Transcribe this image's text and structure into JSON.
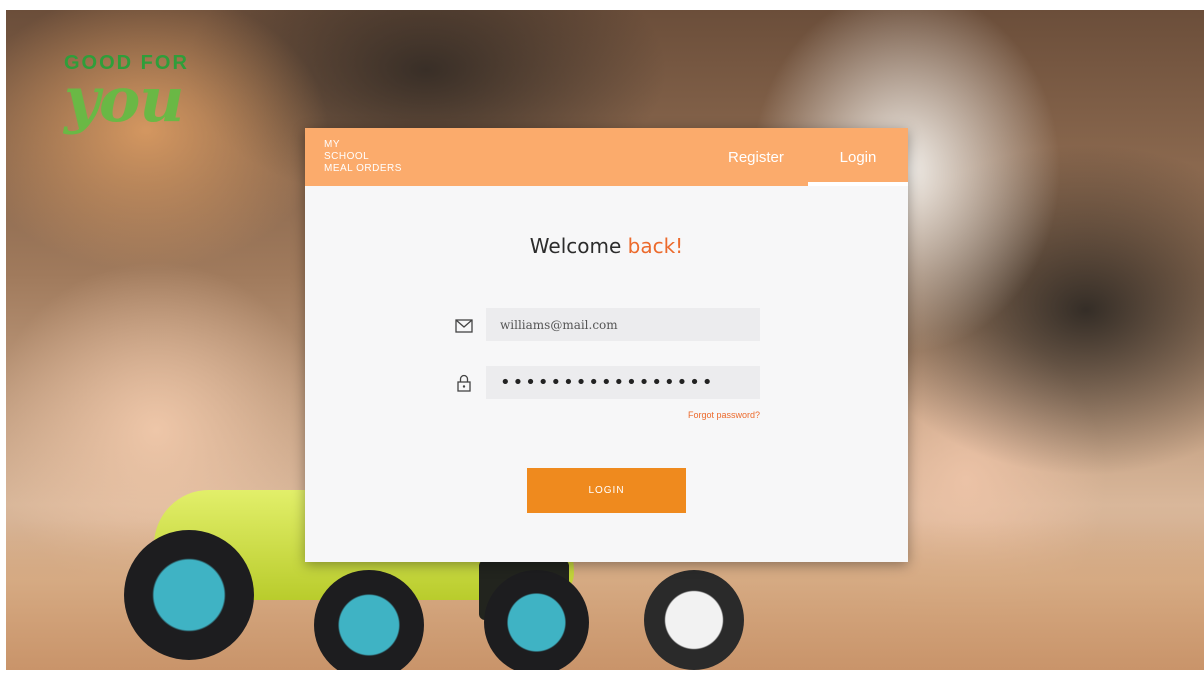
{
  "logo": {
    "line1": "GOOD FOR",
    "line2": "you"
  },
  "header": {
    "brand_lines": [
      "MY",
      "SCHOOL",
      "MEAL ORDERS"
    ],
    "nav_register": "Register",
    "nav_login": "Login"
  },
  "form": {
    "welcome_main": "Welcome ",
    "welcome_accent": "back!",
    "email_value": "williams@mail.com",
    "password_value": "•••••••••••••••••",
    "forgot_label": "Forgot password?",
    "login_button": "LOGIN"
  },
  "colors": {
    "header_bg": "#fbab6c",
    "accent": "#ec6a2c",
    "button_bg": "#ef8a1e",
    "logo_green": "#6ab845"
  },
  "icons": {
    "email": "envelope-icon",
    "password": "lock-icon"
  }
}
